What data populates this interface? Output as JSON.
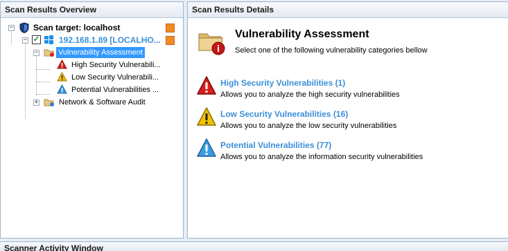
{
  "left_panel": {
    "title": "Scan Results Overview",
    "scan_target": "Scan target: localhost",
    "host": "192.168.1.89 [LOCALHO...",
    "items": {
      "vuln": "Vulnerability Assessment",
      "high": "High Security Vulnerabili...",
      "low": "Low Security Vulnerabili...",
      "potential": "Potential Vulnerabilities ...",
      "network": "Network & Software Audit"
    }
  },
  "right_panel": {
    "title": "Scan Results Details",
    "heading": "Vulnerability Assessment",
    "subheading": "Select one of the following vulnerability categories bellow",
    "categories": [
      {
        "label": "High Security Vulnerabilities (1)",
        "desc": "Allows you to analyze the high security vulnerabilities",
        "color": "#d81e1e"
      },
      {
        "label": "Low Security Vulnerabilities (16)",
        "desc": "Allows you to analyze the low security vulnerabilities",
        "color": "#f2c200"
      },
      {
        "label": "Potential Vulnerabilities (77)",
        "desc": "Allows you to analyze the information security vulnerabilities",
        "color": "#3a9be0"
      }
    ]
  },
  "bottom_panel": {
    "title": "Scanner Activity Window"
  },
  "colors": {
    "link": "#3a8fd8",
    "selection": "#3399ff",
    "accent_orange": "#f08a24"
  }
}
